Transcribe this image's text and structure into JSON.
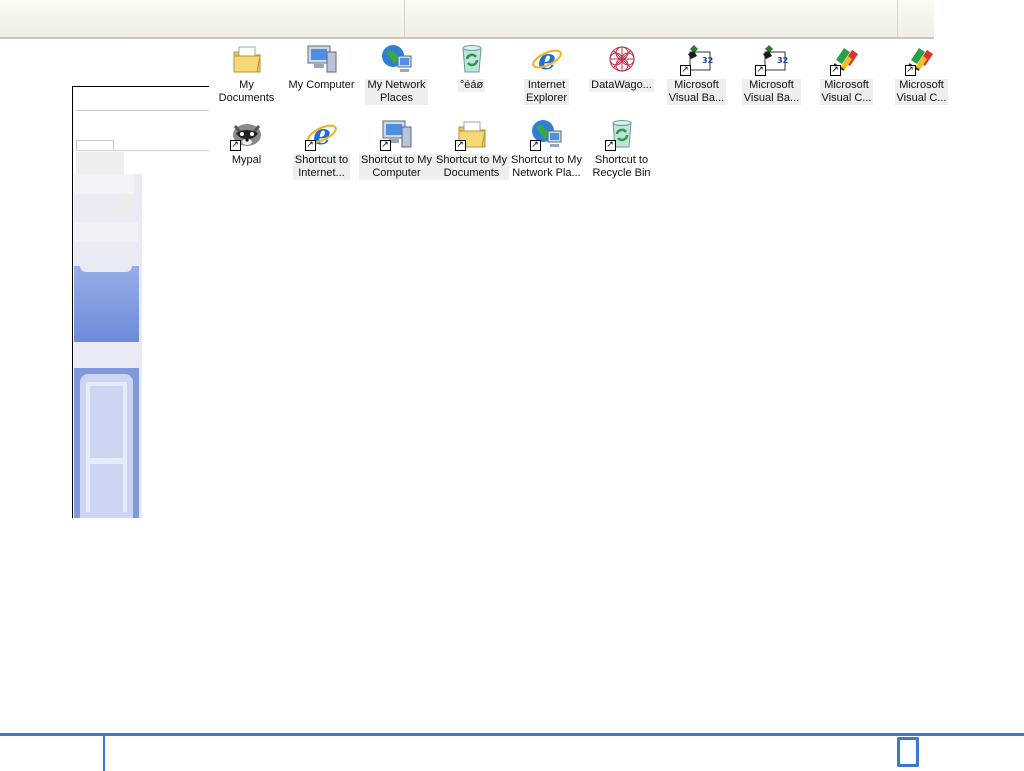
{
  "desktop": {
    "icons_row1": [
      {
        "label": "My Documents",
        "icon": "my-documents-icon",
        "shortcut": false
      },
      {
        "label": "My Computer",
        "icon": "my-computer-icon",
        "shortcut": false
      },
      {
        "label": "My Network\nPlaces",
        "icon": "my-network-places-icon",
        "shortcut": false
      },
      {
        "label": "°éáø",
        "icon": "recycle-bin-icon",
        "shortcut": false
      },
      {
        "label": "Internet\nExplorer",
        "icon": "internet-explorer-icon",
        "shortcut": false
      },
      {
        "label": "DataWago...",
        "icon": "datawagon-icon",
        "shortcut": false
      },
      {
        "label": "Microsoft\nVisual Ba...",
        "icon": "visual-basic-icon",
        "shortcut": true
      },
      {
        "label": "Microsoft\nVisual Ba...",
        "icon": "visual-basic-icon",
        "shortcut": true
      },
      {
        "label": "Microsoft\nVisual C...",
        "icon": "visual-c-icon",
        "shortcut": true
      },
      {
        "label": "Microsoft\nVisual C...",
        "icon": "visual-c-icon",
        "shortcut": true
      }
    ],
    "icons_row2": [
      {
        "label": "Mypal",
        "icon": "mypal-icon",
        "shortcut": true
      },
      {
        "label": "Shortcut to\nInternet...",
        "icon": "internet-explorer-icon",
        "shortcut": true
      },
      {
        "label": "Shortcut to My\nComputer",
        "icon": "my-computer-icon",
        "shortcut": true
      },
      {
        "label": "Shortcut to My\nDocuments",
        "icon": "my-documents-icon",
        "shortcut": true
      },
      {
        "label": "Shortcut to My\nNetwork Pla...",
        "icon": "my-network-places-icon",
        "shortcut": true
      },
      {
        "label": "Shortcut to\nRecycle Bin",
        "icon": "recycle-bin-icon",
        "shortcut": true
      }
    ]
  },
  "colors": {
    "taskbar_accent": "#3a78d2",
    "label_highlight": "#eeeeee"
  }
}
